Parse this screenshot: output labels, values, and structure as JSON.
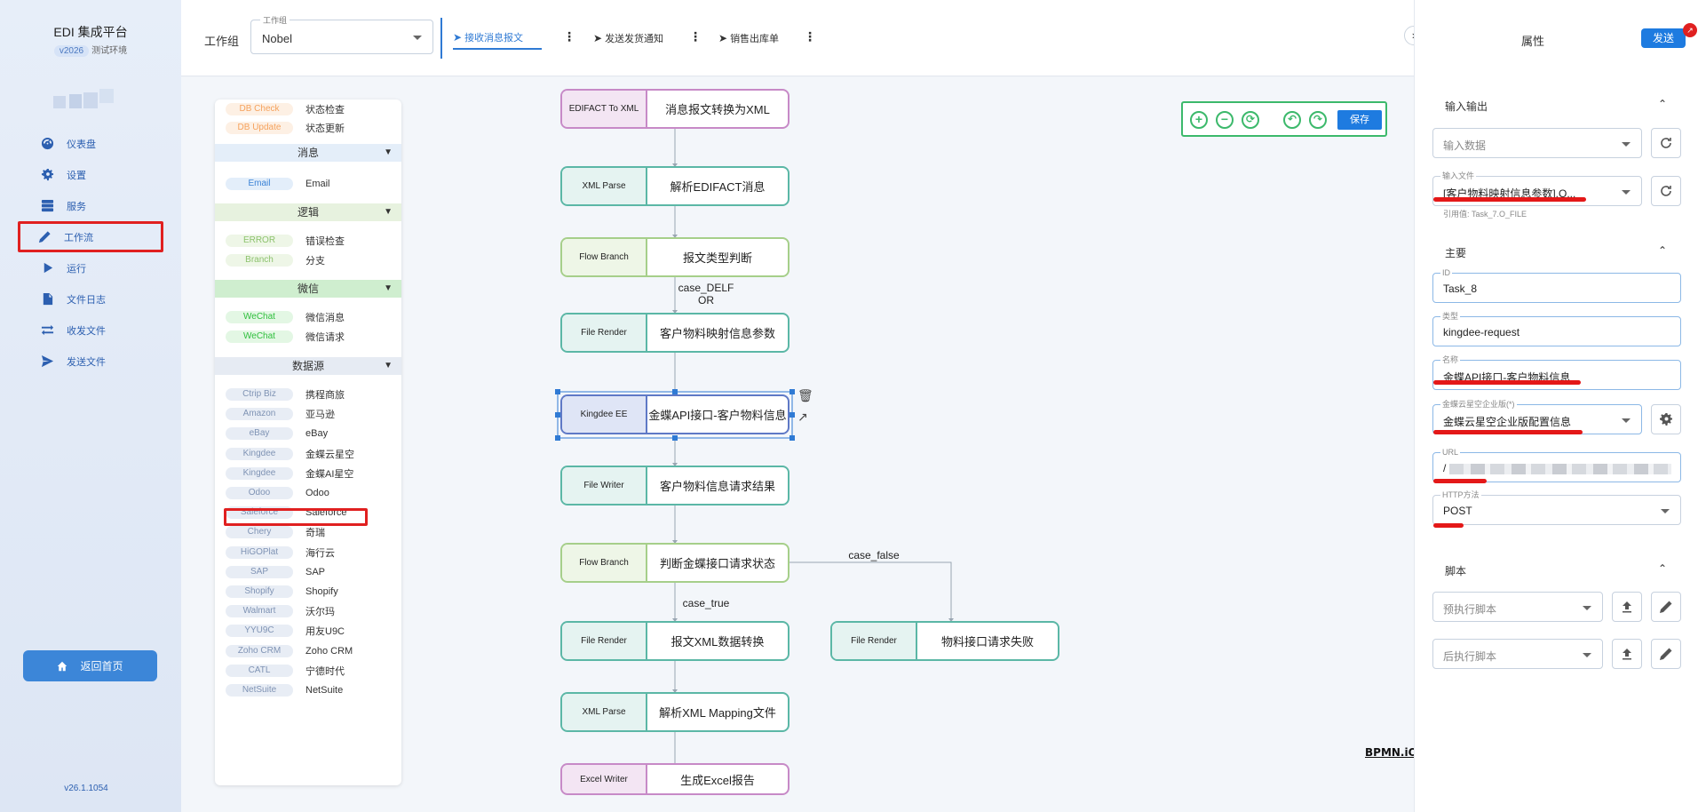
{
  "nav": {
    "title": "EDI 集成平台",
    "version_badge": "v2026",
    "env_label": "测试环境",
    "items": [
      {
        "label": "仪表盘",
        "icon": "dashboard-icon"
      },
      {
        "label": "设置",
        "icon": "gear-icon"
      },
      {
        "label": "服务",
        "icon": "server-icon"
      },
      {
        "label": "工作流",
        "icon": "pencil-icon"
      },
      {
        "label": "运行",
        "icon": "play-icon"
      },
      {
        "label": "文件日志",
        "icon": "document-icon"
      },
      {
        "label": "收发文件",
        "icon": "exchange-icon"
      },
      {
        "label": "发送文件",
        "icon": "send-icon"
      }
    ],
    "active_item": "工作流",
    "home_button": "返回首页",
    "footer_version": "v26.1.1054"
  },
  "topbar": {
    "workgroup_label": "工作组",
    "workgroup_select_legend": "工作组",
    "workgroup_value": "Nobel",
    "tabs": [
      {
        "label": "接收消息报文",
        "active": true
      },
      {
        "label": "发送发货通知",
        "active": false
      },
      {
        "label": "销售出库单",
        "active": false
      }
    ]
  },
  "palette": {
    "top_items": [
      {
        "chip": "DB Check",
        "desc": "状态检查",
        "color": "#f5a25d",
        "bg": "#fdf0e4"
      },
      {
        "chip": "DB Update",
        "desc": "状态更新",
        "color": "#f5a25d",
        "bg": "#fdf0e4"
      }
    ],
    "sections": [
      {
        "title": "消息",
        "bg": "#e4eef9",
        "items": [
          {
            "chip": "Email",
            "desc": "Email",
            "color": "#3a82d6",
            "bg": "#e3eefa"
          }
        ]
      },
      {
        "title": "逻辑",
        "bg": "#e7f2df",
        "items": [
          {
            "chip": "ERROR",
            "desc": "错误检查",
            "color": "#8cc26c",
            "bg": "#eef6e7"
          },
          {
            "chip": "Branch",
            "desc": "分支",
            "color": "#8cc26c",
            "bg": "#eef6e7"
          }
        ]
      },
      {
        "title": "微信",
        "bg": "#cfeecf",
        "items": [
          {
            "chip": "WeChat",
            "desc": "微信消息",
            "color": "#2fbf3d",
            "bg": "#e3f7e4"
          },
          {
            "chip": "WeChat",
            "desc": "微信请求",
            "color": "#2fbf3d",
            "bg": "#e3f7e4"
          }
        ]
      },
      {
        "title": "数据源",
        "bg": "#e6ebf3",
        "items": [
          {
            "chip": "Ctrip Biz",
            "desc": "携程商旅"
          },
          {
            "chip": "Amazon",
            "desc": "亚马逊"
          },
          {
            "chip": "eBay",
            "desc": "eBay"
          },
          {
            "chip": "Kingdee",
            "desc": "金蝶云星空",
            "highlighted": true
          },
          {
            "chip": "Kingdee",
            "desc": "金蝶AI星空"
          },
          {
            "chip": "Odoo",
            "desc": "Odoo"
          },
          {
            "chip": "Saleforce",
            "desc": "Saleforce"
          },
          {
            "chip": "Chery",
            "desc": "奇瑞"
          },
          {
            "chip": "HiGOPlat",
            "desc": "海行云"
          },
          {
            "chip": "SAP",
            "desc": "SAP"
          },
          {
            "chip": "Shopify",
            "desc": "Shopify"
          },
          {
            "chip": "Walmart",
            "desc": "沃尔玛"
          },
          {
            "chip": "YYU9C",
            "desc": "用友U9C"
          },
          {
            "chip": "Zoho CRM",
            "desc": "Zoho CRM"
          },
          {
            "chip": "CATL",
            "desc": "宁德时代"
          },
          {
            "chip": "NetSuite",
            "desc": "NetSuite"
          }
        ]
      }
    ]
  },
  "canvas": {
    "save_label": "保存",
    "brand_watermark": "BPMN.iO",
    "nodes": [
      {
        "type": "EDIFACT To XML",
        "name": "消息报文转换为XML",
        "style": "purple"
      },
      {
        "type": "XML Parse",
        "name": "解析EDIFACT消息",
        "style": "teal"
      },
      {
        "type": "Flow Branch",
        "name": "报文类型判断",
        "style": "green"
      },
      {
        "type": "File Render",
        "name": "客户物料映射信息参数",
        "style": "teal"
      },
      {
        "type": "Kingdee EE",
        "name": "金蝶API接口-客户物料信息",
        "style": "sel"
      },
      {
        "type": "File Writer",
        "name": "客户物料信息请求结果",
        "style": "teal"
      },
      {
        "type": "Flow Branch",
        "name": "判断金蝶接口请求状态",
        "style": "green"
      },
      {
        "type": "File Render",
        "name": "报文XML数据转换",
        "style": "teal"
      },
      {
        "type": "File Render",
        "name": "物料接口请求失败",
        "style": "teal"
      },
      {
        "type": "XML Parse",
        "name": "解析XML Mapping文件",
        "style": "teal"
      },
      {
        "type": "Excel Writer",
        "name": "生成Excel报告",
        "style": "purple"
      }
    ],
    "edge_labels": {
      "case_delf_line1": "case_DELF",
      "case_delf_line2": "OR",
      "case_true": "case_true",
      "case_false": "case_false"
    }
  },
  "properties": {
    "title": "属性",
    "send_label": "发送",
    "io_group": "输入输出",
    "input_data_placeholder": "输入数据",
    "input_file_label": "输入文件",
    "input_file_value": "[客户物料映射信息参数].O...",
    "input_file_ref": "引用值: Task_7.O_FILE",
    "main_group": "主要",
    "id_label": "ID",
    "id_value": "Task_8",
    "type_label": "类型",
    "type_value": "kingdee-request",
    "name_label": "名称",
    "name_value": "金蝶API接口-客户物料信息",
    "kingdee_label": "金蝶云星空企业版(*)",
    "kingdee_value": "金蝶云星空企业版配置信息",
    "url_label": "URL",
    "url_value": "/",
    "http_label": "HTTP方法",
    "http_value": "POST",
    "script_group": "脚本",
    "pre_script_placeholder": "预执行脚本",
    "post_script_placeholder": "后执行脚本"
  },
  "colors": {
    "accent": "#1e7be0",
    "highlight_red": "#e02020",
    "node_teal": "#5bb7a6",
    "node_green": "#a6cf8a",
    "node_purple": "#c78ac7",
    "node_selected": "#5f79c6"
  }
}
